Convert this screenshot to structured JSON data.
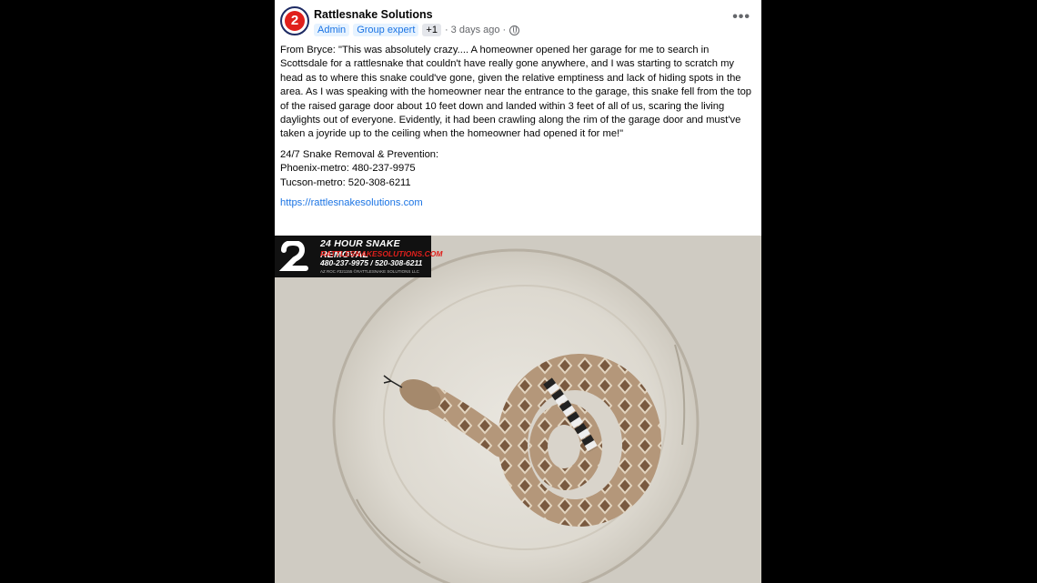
{
  "post": {
    "page_name": "Rattlesnake Solutions",
    "avatar_letter": "2",
    "badges": [
      "Admin",
      "Group expert",
      "+1"
    ],
    "time": "· 3 days ago ·",
    "more_label": "•••",
    "body": "From Bryce: \"This was absolutely crazy.... A homeowner opened her garage for me to search in Scottsdale for a rattlesnake that couldn't have really gone anywhere, and I was starting to scratch my head as to where this snake could've gone, given the relative emptiness and lack of hiding spots in the area. As I was speaking with the homeowner near the entrance to the garage, this snake fell from the top of the raised garage door about 10 feet down and landed within 3 feet of all of us, scaring the living daylights out of everyone. Evidently, it had been crawling along the rim of the garage door and must've taken a joyride up to the ceiling when the homeowner had opened it for me!\"",
    "contact_lines": [
      "24/7 Snake Removal & Prevention:",
      "Phoenix-metro: 480-237-9975",
      "Tucson-metro: 520-308-6211"
    ],
    "link": "https://rattlesnakesolutions.com"
  },
  "banner": {
    "line1": "24 HOUR SNAKE REMOVAL",
    "line2": "RATTLESNAKESOLUTIONS.COM",
    "line3": "480-237-9975 / 520-308-6211",
    "line4": "AZ ROC #321155   ©RATTLESNAKE SOLUTIONS LLC"
  }
}
